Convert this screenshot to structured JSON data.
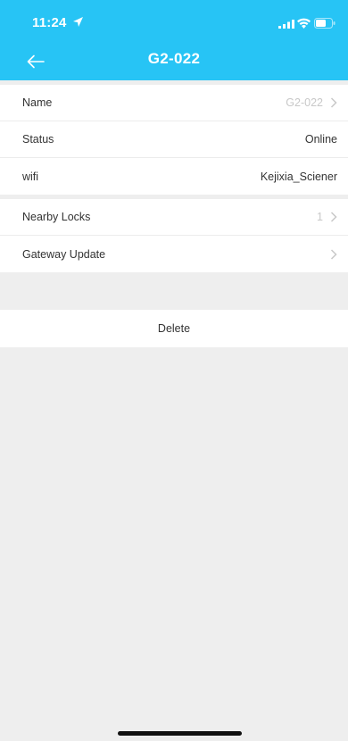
{
  "status_bar": {
    "time": "11:24",
    "icons": [
      "location-arrow-icon",
      "signal-icon",
      "wifi-icon",
      "battery-icon"
    ]
  },
  "nav": {
    "title": "G2-022",
    "back_icon": "arrow-left-icon"
  },
  "info_group": [
    {
      "label": "Name",
      "value": "G2-022",
      "chevron": true
    },
    {
      "label": "Status",
      "value": "Online",
      "chevron": false
    },
    {
      "label": "wifi",
      "value": "Kejixia_Sciener",
      "chevron": false
    }
  ],
  "lock_group": [
    {
      "label": "Nearby Locks",
      "value": "1",
      "chevron": true
    },
    {
      "label": "Gateway Update",
      "value": "",
      "chevron": true
    }
  ],
  "delete_label": "Delete",
  "colors": {
    "header": "#27c4f5",
    "background": "#eeeeee",
    "muted_text": "#c8c8c8"
  }
}
